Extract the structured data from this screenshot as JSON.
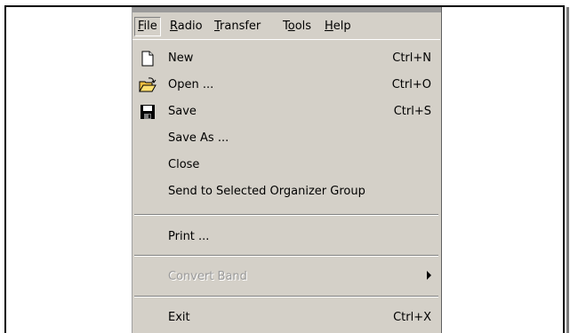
{
  "menubar": {
    "items": [
      {
        "mnemonic": "F",
        "rest": "ile"
      },
      {
        "mnemonic": "R",
        "rest": "adio"
      },
      {
        "mnemonic": "T",
        "rest": "ransfer"
      },
      {
        "pre": "T",
        "mnemonic": "o",
        "rest": "ols"
      },
      {
        "mnemonic": "H",
        "rest": "elp"
      }
    ]
  },
  "file_menu": {
    "new": {
      "label": "New",
      "shortcut": "Ctrl+N",
      "icon": "new-document-icon"
    },
    "open": {
      "label": "Open ...",
      "shortcut": "Ctrl+O",
      "icon": "open-folder-icon"
    },
    "save": {
      "label": "Save",
      "shortcut": "Ctrl+S",
      "icon": "floppy-disk-icon"
    },
    "save_as": {
      "label": "Save As ..."
    },
    "close": {
      "label": "Close"
    },
    "send": {
      "label": "Send to Selected Organizer Group"
    },
    "print": {
      "label": "Print ..."
    },
    "convert_band": {
      "label": "Convert Band",
      "disabled": true
    },
    "exit": {
      "label": "Exit",
      "shortcut": "Ctrl+X"
    }
  },
  "colors": {
    "menu_bg": "#d4d0c8",
    "disabled_text": "#9a9a9a"
  }
}
